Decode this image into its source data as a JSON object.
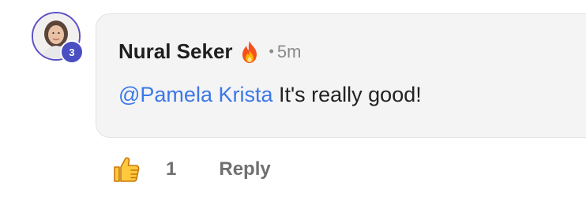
{
  "comment": {
    "author": "Nural Seker",
    "author_badge_icon": "fire-icon",
    "separator": "•",
    "timestamp": "5m",
    "mention": "@Pamela Krista",
    "text": " It's really good!",
    "avatar_level": "3",
    "like_count": "1",
    "reply_label": "Reply"
  },
  "colors": {
    "mention": "#3b78e7",
    "badge": "#4a4fc2",
    "bubble": "#f4f4f5",
    "avatar_ring": "#5b4fc4"
  }
}
